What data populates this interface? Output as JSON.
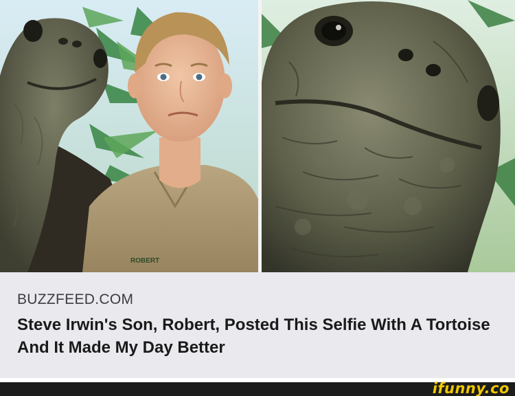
{
  "post": {
    "image_left_caption": "ROBERT",
    "source": "BUZZFEED.COM",
    "headline": "Steve Irwin's Son, Robert, Posted This Selfie With A Tortoise And It Made My Day Better"
  },
  "footer": {
    "watermark": "ifunny.co"
  }
}
